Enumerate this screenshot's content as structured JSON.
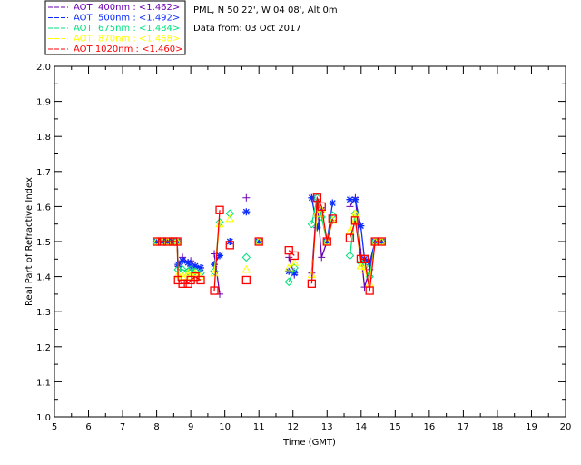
{
  "header": {
    "site": "PML, N 50 22', W 04 08', Alt 0m",
    "date": "Data from: 03 Oct 2017"
  },
  "chart_data": {
    "type": "line",
    "xlabel": "Time (GMT)",
    "ylabel": "Real Part of Refractive Index",
    "xlim": [
      5,
      20
    ],
    "ylim": [
      1.0,
      2.0
    ],
    "xticks": [
      "5",
      "6",
      "7",
      "8",
      "9",
      "10",
      "11",
      "12",
      "13",
      "14",
      "15",
      "16",
      "17",
      "18",
      "19",
      "20"
    ],
    "yticks": [
      "1.0",
      "1.1",
      "1.2",
      "1.3",
      "1.4",
      "1.5",
      "1.6",
      "1.7",
      "1.8",
      "1.9",
      "2.0"
    ],
    "legend_position": "top-left",
    "series": [
      {
        "name": "AOT  400nm : <1.462>",
        "color": "#6a00b0",
        "marker": "plus",
        "segments": [
          [
            [
              8.0,
              1.5
            ],
            [
              8.16,
              1.5
            ],
            [
              8.32,
              1.5
            ],
            [
              8.48,
              1.5
            ],
            [
              8.6,
              1.5
            ],
            [
              8.63,
              1.43
            ],
            [
              8.76,
              1.455
            ],
            [
              8.92,
              1.44
            ],
            [
              9.0,
              1.445
            ],
            [
              9.13,
              1.43
            ],
            [
              9.29,
              1.425
            ]
          ],
          [
            [
              9.69,
              1.465
            ],
            [
              9.85,
              1.35
            ]
          ],
          [
            [
              10.15,
              1.5
            ]
          ],
          [
            [
              10.63,
              1.625
            ]
          ],
          [
            [
              11.0,
              1.5
            ]
          ],
          [
            [
              11.88,
              1.455
            ],
            [
              12.04,
              1.405
            ]
          ],
          [
            [
              12.55,
              1.41
            ],
            [
              12.71,
              1.615
            ],
            [
              12.84,
              1.455
            ],
            [
              13.0,
              1.5
            ],
            [
              13.16,
              1.56
            ]
          ],
          [
            [
              13.67,
              1.6
            ],
            [
              13.83,
              1.625
            ],
            [
              13.99,
              1.47
            ],
            [
              14.1,
              1.37
            ],
            [
              14.25,
              1.42
            ],
            [
              14.41,
              1.5
            ],
            [
              14.6,
              1.5
            ]
          ]
        ]
      },
      {
        "name": "AOT  500nm : <1.492>",
        "color": "#0a2cff",
        "marker": "asterisk",
        "segments": [
          [
            [
              8.0,
              1.5
            ],
            [
              8.16,
              1.5
            ],
            [
              8.32,
              1.5
            ],
            [
              8.48,
              1.5
            ],
            [
              8.6,
              1.5
            ],
            [
              8.63,
              1.435
            ],
            [
              8.76,
              1.445
            ],
            [
              8.92,
              1.44
            ],
            [
              9.0,
              1.43
            ],
            [
              9.13,
              1.43
            ],
            [
              9.29,
              1.425
            ]
          ],
          [
            [
              9.69,
              1.435
            ],
            [
              9.85,
              1.46
            ]
          ],
          [
            [
              10.15,
              1.5
            ]
          ],
          [
            [
              10.63,
              1.585
            ]
          ],
          [
            [
              11.0,
              1.5
            ]
          ],
          [
            [
              11.88,
              1.415
            ],
            [
              12.04,
              1.41
            ]
          ],
          [
            [
              12.55,
              1.625
            ],
            [
              12.71,
              1.54
            ],
            [
              12.84,
              1.59
            ],
            [
              13.0,
              1.5
            ],
            [
              13.16,
              1.61
            ]
          ],
          [
            [
              13.67,
              1.62
            ],
            [
              13.83,
              1.62
            ],
            [
              13.99,
              1.545
            ],
            [
              14.1,
              1.45
            ],
            [
              14.25,
              1.44
            ],
            [
              14.41,
              1.5
            ],
            [
              14.6,
              1.5
            ]
          ]
        ]
      },
      {
        "name": "AOT  675nm : <1.484>",
        "color": "#00e27a",
        "marker": "diamond",
        "segments": [
          [
            [
              8.0,
              1.5
            ],
            [
              8.16,
              1.5
            ],
            [
              8.32,
              1.5
            ],
            [
              8.48,
              1.5
            ],
            [
              8.6,
              1.5
            ],
            [
              8.63,
              1.42
            ],
            [
              8.76,
              1.42
            ],
            [
              8.92,
              1.415
            ],
            [
              9.0,
              1.42
            ],
            [
              9.13,
              1.415
            ],
            [
              9.29,
              1.41
            ]
          ],
          [
            [
              9.69,
              1.415
            ],
            [
              9.85,
              1.555
            ]
          ],
          [
            [
              10.15,
              1.58
            ]
          ],
          [
            [
              10.63,
              1.455
            ]
          ],
          [
            [
              11.0,
              1.5
            ]
          ],
          [
            [
              11.88,
              1.385
            ],
            [
              12.04,
              1.425
            ]
          ],
          [
            [
              12.55,
              1.55
            ],
            [
              12.71,
              1.625
            ],
            [
              12.84,
              1.57
            ],
            [
              13.0,
              1.5
            ],
            [
              13.16,
              1.575
            ]
          ],
          [
            [
              13.67,
              1.46
            ],
            [
              13.83,
              1.58
            ],
            [
              13.99,
              1.44
            ],
            [
              14.1,
              1.43
            ],
            [
              14.25,
              1.4
            ],
            [
              14.41,
              1.5
            ],
            [
              14.6,
              1.5
            ]
          ]
        ]
      },
      {
        "name": "AOT  870nm : <1.468>",
        "color": "#ffff00",
        "marker": "triangle",
        "segments": [
          [
            [
              8.0,
              1.5
            ],
            [
              8.16,
              1.5
            ],
            [
              8.32,
              1.5
            ],
            [
              8.48,
              1.5
            ],
            [
              8.6,
              1.5
            ],
            [
              8.63,
              1.405
            ],
            [
              8.76,
              1.4
            ],
            [
              8.92,
              1.41
            ],
            [
              9.0,
              1.4
            ],
            [
              9.13,
              1.41
            ],
            [
              9.29,
              1.4
            ]
          ],
          [
            [
              9.69,
              1.41
            ],
            [
              9.85,
              1.55
            ]
          ],
          [
            [
              10.15,
              1.565
            ]
          ],
          [
            [
              10.63,
              1.42
            ]
          ],
          [
            [
              11.0,
              1.5
            ]
          ],
          [
            [
              11.88,
              1.425
            ],
            [
              12.04,
              1.44
            ]
          ],
          [
            [
              12.55,
              1.405
            ],
            [
              12.71,
              1.58
            ],
            [
              12.84,
              1.59
            ],
            [
              13.0,
              1.5
            ],
            [
              13.16,
              1.56
            ]
          ],
          [
            [
              13.67,
              1.53
            ],
            [
              13.83,
              1.58
            ],
            [
              13.99,
              1.43
            ],
            [
              14.1,
              1.42
            ],
            [
              14.25,
              1.38
            ],
            [
              14.41,
              1.5
            ],
            [
              14.6,
              1.5
            ]
          ]
        ]
      },
      {
        "name": "AOT 1020nm : <1.460>",
        "color": "#ff0000",
        "marker": "square",
        "segments": [
          [
            [
              8.0,
              1.5
            ],
            [
              8.16,
              1.5
            ],
            [
              8.32,
              1.5
            ],
            [
              8.48,
              1.5
            ],
            [
              8.6,
              1.5
            ],
            [
              8.63,
              1.39
            ],
            [
              8.76,
              1.38
            ],
            [
              8.92,
              1.38
            ],
            [
              9.0,
              1.39
            ],
            [
              9.13,
              1.4
            ],
            [
              9.29,
              1.39
            ]
          ],
          [
            [
              9.69,
              1.36
            ],
            [
              9.85,
              1.59
            ]
          ],
          [
            [
              10.15,
              1.49
            ]
          ],
          [
            [
              10.63,
              1.39
            ]
          ],
          [
            [
              11.0,
              1.5
            ]
          ],
          [
            [
              11.88,
              1.475
            ],
            [
              12.04,
              1.46
            ]
          ],
          [
            [
              12.55,
              1.38
            ],
            [
              12.71,
              1.625
            ],
            [
              12.84,
              1.6
            ],
            [
              13.0,
              1.5
            ],
            [
              13.16,
              1.565
            ]
          ],
          [
            [
              13.67,
              1.51
            ],
            [
              13.83,
              1.56
            ],
            [
              13.99,
              1.45
            ],
            [
              14.1,
              1.45
            ],
            [
              14.25,
              1.36
            ],
            [
              14.41,
              1.5
            ],
            [
              14.6,
              1.5
            ]
          ]
        ]
      }
    ]
  }
}
